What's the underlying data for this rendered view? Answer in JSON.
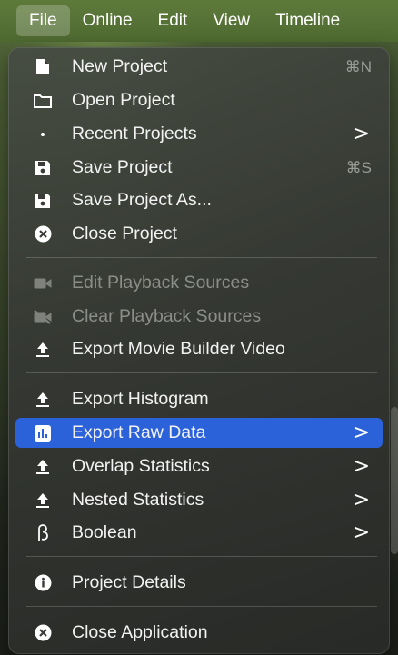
{
  "menubar": {
    "items": [
      "File",
      "Online",
      "Edit",
      "View",
      "Timeline"
    ]
  },
  "menu": {
    "items": [
      {
        "label": "New Project",
        "shortcut": "⌘N",
        "icon": "document-icon"
      },
      {
        "label": "Open Project",
        "icon": "folder-icon"
      },
      {
        "label": "Recent Projects",
        "submenu": ">",
        "icon": "dot-icon"
      },
      {
        "label": "Save Project",
        "shortcut": "⌘S",
        "icon": "floppy-disk-icon"
      },
      {
        "label": "Save Project As...",
        "icon": "floppy-disk-icon"
      },
      {
        "label": "Close Project",
        "icon": "close-circle-icon"
      },
      {
        "label": "Edit Playback Sources",
        "disabled": true,
        "icon": "video-camera-icon"
      },
      {
        "label": "Clear Playback Sources",
        "disabled": true,
        "icon": "video-camera-off-icon"
      },
      {
        "label": "Export Movie Builder Video",
        "icon": "export-icon"
      },
      {
        "label": "Export Histogram",
        "icon": "export-icon"
      },
      {
        "label": "Export Raw Data",
        "submenu": ">",
        "highlight": true,
        "icon": "bar-chart-icon"
      },
      {
        "label": "Overlap Statistics",
        "submenu": ">",
        "icon": "export-icon"
      },
      {
        "label": "Nested Statistics",
        "submenu": ">",
        "icon": "export-icon"
      },
      {
        "label": "Boolean",
        "submenu": ">",
        "icon": "beta-icon"
      },
      {
        "label": "Project Details",
        "icon": "info-icon"
      },
      {
        "label": "Close Application",
        "icon": "close-circle-icon"
      }
    ]
  },
  "colors": {
    "highlight": "#2c62d9",
    "menubar": "#5e7a3a"
  }
}
